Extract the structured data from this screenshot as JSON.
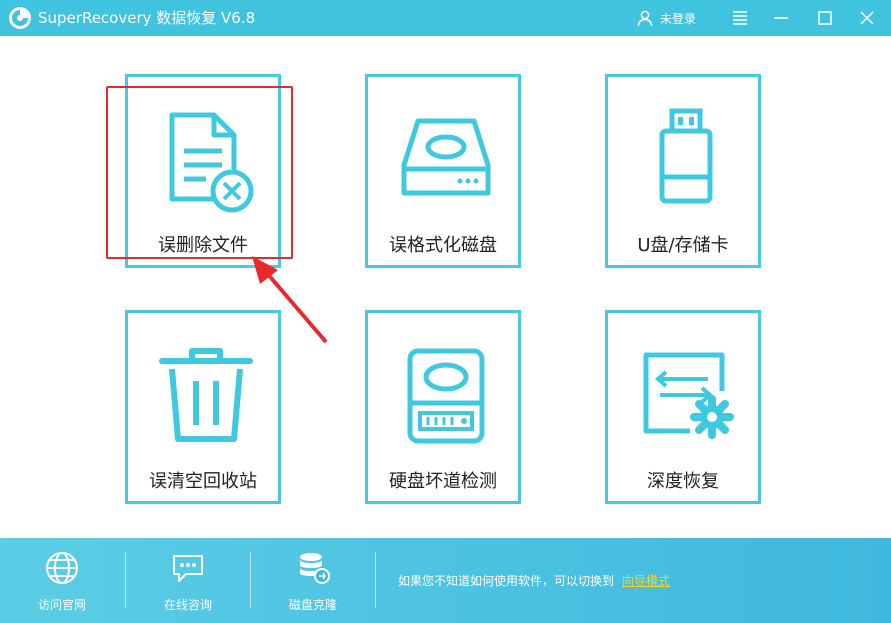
{
  "app": {
    "title": "SuperRecovery 数据恢复 V6.8",
    "user_label": "未登录"
  },
  "icons": {
    "logo": "app-logo-icon",
    "user": "user-icon",
    "menu": "menu-icon",
    "minimize": "minimize-icon",
    "maximize": "maximize-icon",
    "close": "close-icon"
  },
  "tiles": [
    {
      "label": "误删除文件",
      "icon": "deleted-file-icon"
    },
    {
      "label": "误格式化磁盘",
      "icon": "format-disk-icon"
    },
    {
      "label": "U盘/存储卡",
      "icon": "usb-drive-icon"
    },
    {
      "label": "误清空回收站",
      "icon": "trash-bin-icon"
    },
    {
      "label": "硬盘坏道检测",
      "icon": "hard-disk-icon"
    },
    {
      "label": "深度恢复",
      "icon": "deep-recovery-icon"
    }
  ],
  "footer": {
    "items": [
      {
        "label": "访问官网",
        "icon": "globe-icon"
      },
      {
        "label": "在线咨询",
        "icon": "chat-icon"
      },
      {
        "label": "磁盘克隆",
        "icon": "database-icon"
      }
    ],
    "hint_text": "如果您不知道如何使用软件，可以切换到",
    "guide_link": "向导模式"
  },
  "colors": {
    "titlebar": "#3fc3de",
    "tile_border": "#44cbe0",
    "icon": "#3fc9df",
    "highlight": "#e8282b",
    "link": "#f6d428"
  }
}
